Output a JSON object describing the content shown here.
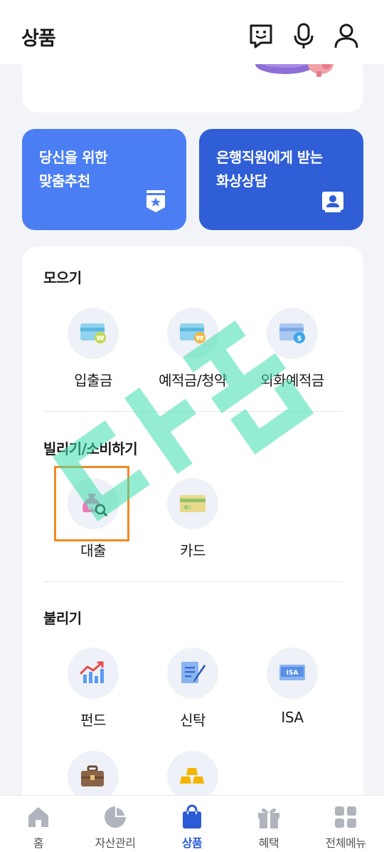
{
  "header": {
    "title": "상품",
    "icons": [
      "chatbot-icon",
      "microphone-icon",
      "user-icon"
    ]
  },
  "promos": [
    {
      "line1": "당신을 위한",
      "line2": "맞춤추천",
      "icon": "star-badge-icon",
      "color": "#4a7ef2"
    },
    {
      "line1": "은행직원에게 받는",
      "line2": "화상상담",
      "icon": "video-consult-icon",
      "color": "#2f5ed6"
    }
  ],
  "sections": [
    {
      "title": "모으기",
      "items": [
        {
          "label": "입출금",
          "icon": "bankbook-won-icon"
        },
        {
          "label": "예적금/청약",
          "icon": "savings-won-icon"
        },
        {
          "label": "외화예적금",
          "icon": "foreign-deposit-dollar-icon"
        }
      ]
    },
    {
      "title": "빌리기/소비하기",
      "items": [
        {
          "label": "대출",
          "icon": "loan-bag-icon"
        },
        {
          "label": "카드",
          "icon": "card-icon"
        }
      ]
    },
    {
      "title": "불리기",
      "items": [
        {
          "label": "펀드",
          "icon": "fund-chart-icon"
        },
        {
          "label": "신탁",
          "icon": "trust-document-icon"
        },
        {
          "label": "ISA",
          "icon": "isa-card-icon"
        },
        {
          "label": "",
          "icon": "briefcase-icon"
        },
        {
          "label": "",
          "icon": "gold-bars-icon"
        }
      ]
    }
  ],
  "tabs": [
    {
      "label": "홈",
      "icon": "home-icon",
      "active": false
    },
    {
      "label": "자산관리",
      "icon": "pie-chart-icon",
      "active": false
    },
    {
      "label": "상품",
      "icon": "shopping-bag-icon",
      "active": true
    },
    {
      "label": "혜택",
      "icon": "gift-icon",
      "active": false
    },
    {
      "label": "전체메뉴",
      "icon": "grid-menu-icon",
      "active": false
    }
  ],
  "colors": {
    "accent": "#2b5bd7",
    "highlight": "#f08a24",
    "watermark": "#3ee0b0"
  }
}
